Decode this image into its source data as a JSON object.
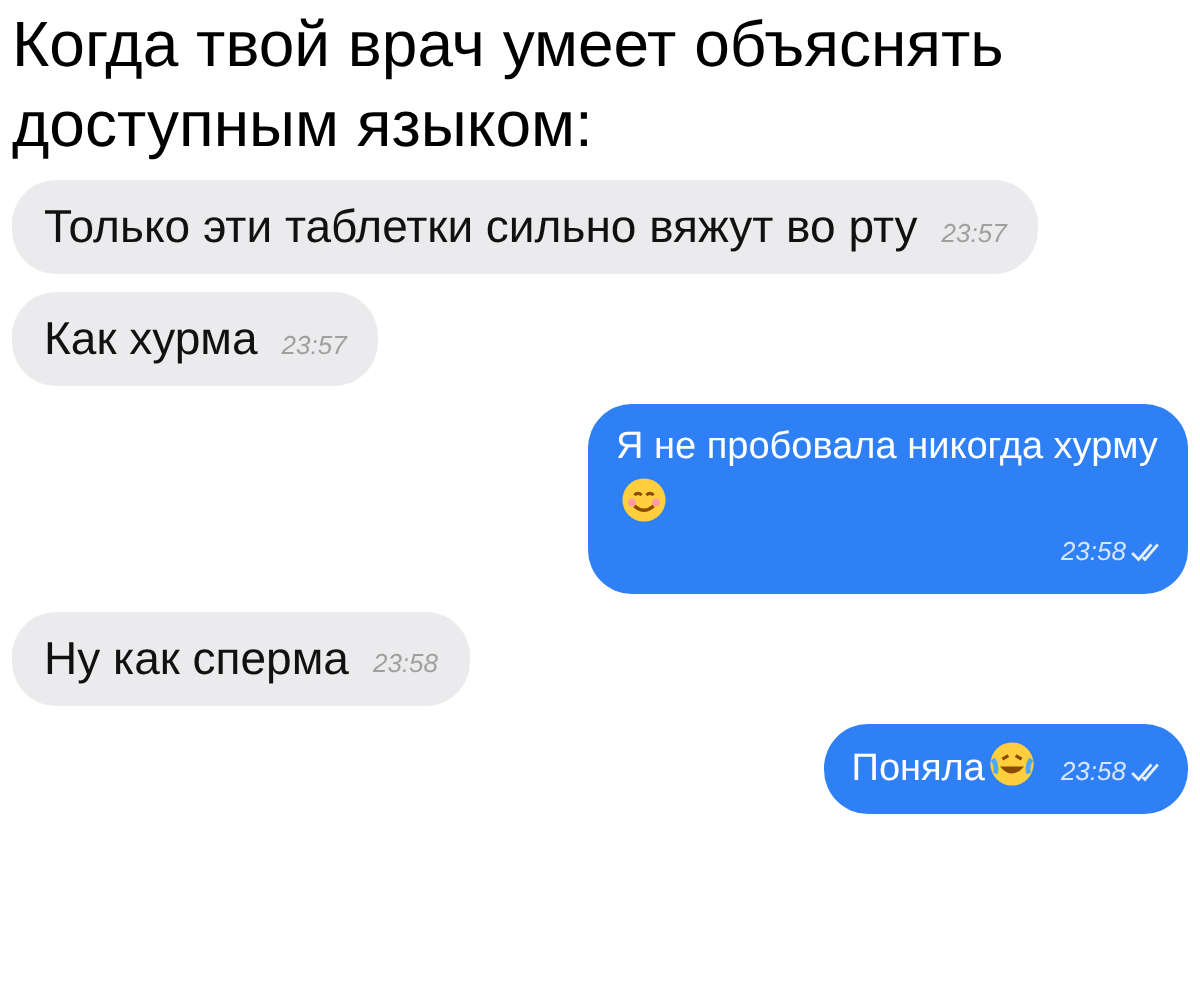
{
  "caption": "Когда твой врач умеет объяснять доступным языком:",
  "messages": [
    {
      "kind": "incoming",
      "text": "Только эти таблетки сильно вяжут во рту",
      "time": "23:57"
    },
    {
      "kind": "incoming",
      "text": "Как хурма",
      "time": "23:57"
    },
    {
      "kind": "outgoing",
      "text": "Я не пробовала никогда хурму",
      "emoji": {
        "kind": "smile"
      },
      "time": "23:58",
      "read": true
    },
    {
      "kind": "incoming",
      "text": "Ну как сперма",
      "time": "23:58"
    },
    {
      "kind": "outgoing",
      "text": "Поняла",
      "emoji": {
        "kind": "laugh"
      },
      "time": "23:58",
      "read": true
    }
  ]
}
